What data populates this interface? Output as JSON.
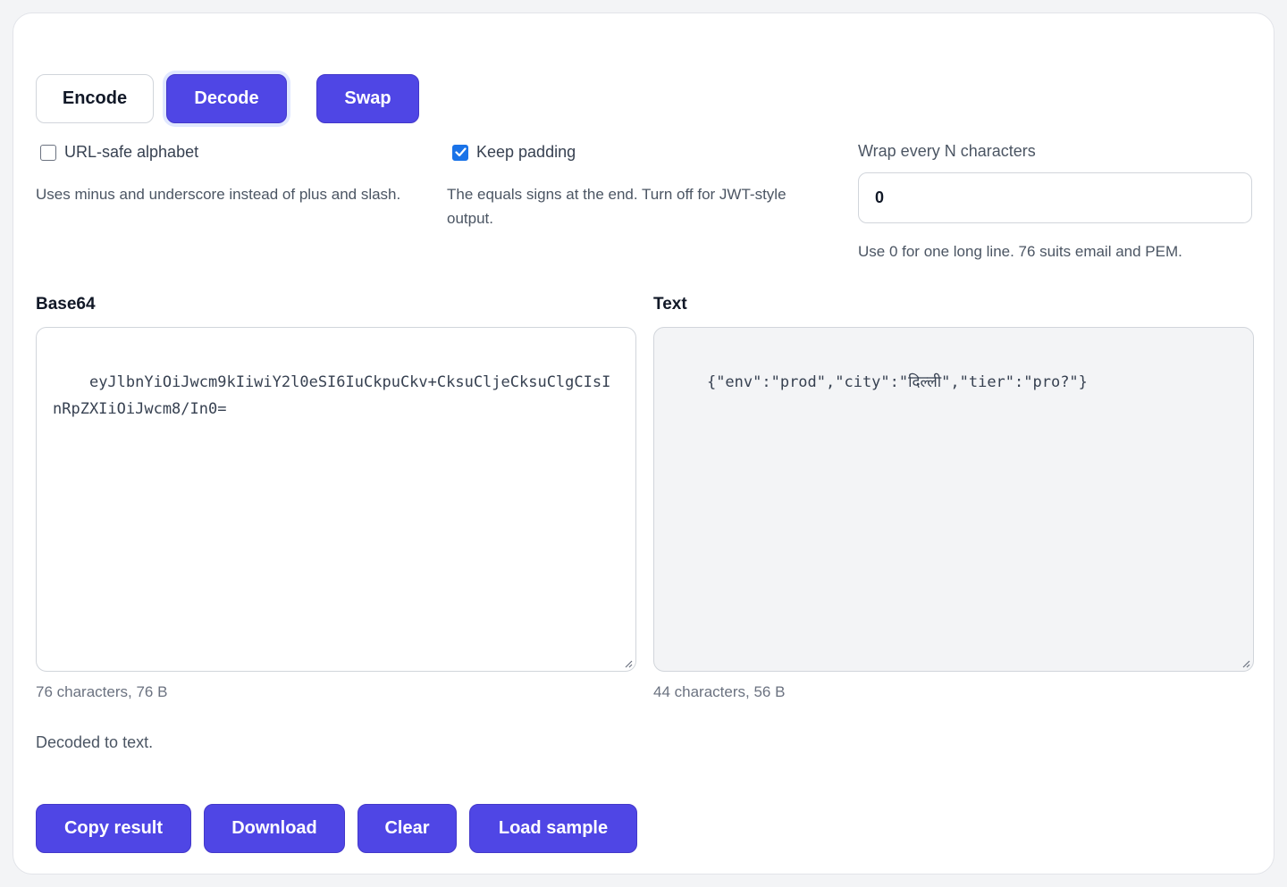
{
  "mode": {
    "encode_label": "Encode",
    "decode_label": "Decode",
    "swap_label": "Swap",
    "active": "Decode"
  },
  "options": {
    "url_safe": {
      "label": "URL-safe alphabet",
      "checked": false,
      "hint": "Uses minus and underscore instead of plus and slash."
    },
    "keep_padding": {
      "label": "Keep padding",
      "checked": true,
      "hint": "The equals signs at the end. Turn off for JWT-style output."
    },
    "wrap": {
      "label": "Wrap every N characters",
      "value": "0",
      "hint": "Use 0 for one long line. 76 suits email and PEM."
    }
  },
  "panes": {
    "base64": {
      "label": "Base64",
      "value": "eyJlbnYiOiJwcm9kIiwiY2l0eSI6IuCkpuCkv+CksuCljeCksuClgCIsInRpZXIiOiJwcm8/In0=",
      "meta": "76 characters, 76 B"
    },
    "text": {
      "label": "Text",
      "value": "{\"env\":\"prod\",\"city\":\"दिल्ली\",\"tier\":\"pro?\"}",
      "meta": "44 characters, 56 B"
    }
  },
  "status": "Decoded to text.",
  "actions": {
    "copy_label": "Copy result",
    "download_label": "Download",
    "clear_label": "Clear",
    "sample_label": "Load sample"
  },
  "colors": {
    "accent": "#4f46e5",
    "checkbox": "#1a73e8"
  }
}
